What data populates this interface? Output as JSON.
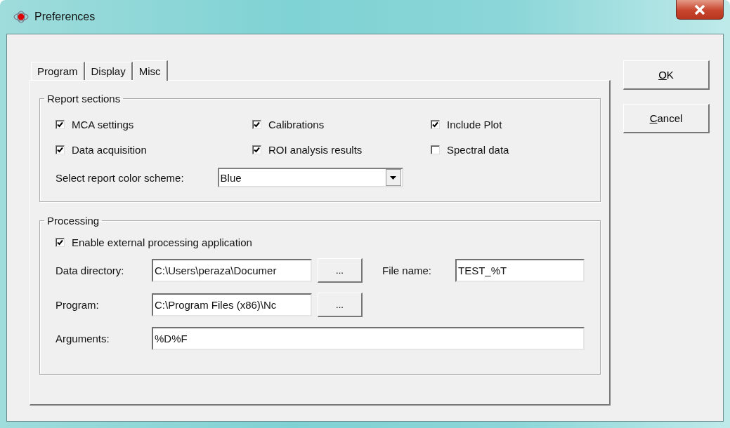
{
  "window": {
    "title": "Preferences"
  },
  "tabs": [
    {
      "label": "Program",
      "selected": false
    },
    {
      "label": "Display",
      "selected": false
    },
    {
      "label": "Misc",
      "selected": true
    }
  ],
  "report_sections": {
    "title": "Report sections",
    "options": [
      {
        "label": "MCA settings",
        "checked": true
      },
      {
        "label": "Calibrations",
        "checked": true
      },
      {
        "label": "Include Plot",
        "checked": true
      },
      {
        "label": "Data acquisition",
        "checked": true
      },
      {
        "label": "ROI analysis results",
        "checked": true
      },
      {
        "label": "Spectral data",
        "checked": false
      }
    ],
    "color_scheme": {
      "label": "Select report color scheme:",
      "value": "Blue"
    }
  },
  "processing": {
    "title": "Processing",
    "enable": {
      "label": "Enable external processing application",
      "checked": true
    },
    "data_directory": {
      "label": "Data directory:",
      "value": "C:\\Users\\peraza\\Documer",
      "browse": "..."
    },
    "file_name": {
      "label": "File name:",
      "value": "TEST_%T"
    },
    "program": {
      "label": "Program:",
      "value": "C:\\Program Files (x86)\\Nc",
      "browse": "..."
    },
    "arguments": {
      "label": "Arguments:",
      "value": "%D%F"
    }
  },
  "buttons": [
    {
      "accel": "O",
      "rest": "K"
    },
    {
      "accel": "C",
      "rest": "ancel"
    }
  ]
}
